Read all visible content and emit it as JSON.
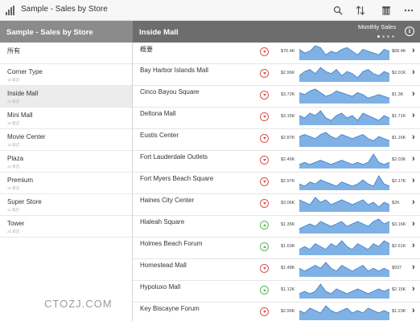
{
  "app": {
    "title": "Sample - Sales by Store"
  },
  "toolbar": {
    "search_icon": "search-icon",
    "sort_icon": "sort-icon",
    "columns_icon": "columns-icon",
    "more_icon": "more-icon"
  },
  "sidebar": {
    "header": "Sample - Sales by Store",
    "items": [
      {
        "label": "所有",
        "sub": ""
      },
      {
        "label": "Corner Type",
        "sub": "18 家店"
      },
      {
        "label": "Inside Mall",
        "sub": "22 家店"
      },
      {
        "label": "Mini Mall",
        "sub": "15 家店"
      },
      {
        "label": "Movie Center",
        "sub": "13 家店"
      },
      {
        "label": "Plaza",
        "sub": "14 家店"
      },
      {
        "label": "Premium",
        "sub": "19 家店"
      },
      {
        "label": "Super Store",
        "sub": "11 家店"
      },
      {
        "label": "Tower",
        "sub": "25 家店"
      }
    ],
    "selected_index": 2
  },
  "main": {
    "title": "Inside Mall",
    "subtitle": "Monthly Sales",
    "info_icon": "info-icon",
    "colors": {
      "down": "#d9534f",
      "up": "#5cb85c",
      "spark_fill": "#7fb1e4",
      "spark_line": "#3d7cc9"
    },
    "rows": [
      {
        "name": "概要",
        "trend": "down",
        "start": "$76.4K",
        "end": "$68.4K",
        "spark": [
          6,
          4,
          5,
          8,
          7,
          3,
          5,
          4,
          6,
          7,
          5,
          3,
          6,
          5,
          4,
          3,
          6,
          5
        ]
      },
      {
        "name": "Bay Harbor Islands Mall",
        "trend": "down",
        "start": "$2.96K",
        "end": "$2.01K",
        "spark": [
          3,
          5,
          6,
          4,
          7,
          5,
          4,
          6,
          3,
          5,
          4,
          2,
          5,
          6,
          4,
          3,
          5,
          4
        ]
      },
      {
        "name": "Cinco Bayou Square",
        "trend": "down",
        "start": "$3.72K",
        "end": "$1.3K",
        "spark": [
          6,
          5,
          7,
          8,
          6,
          4,
          5,
          7,
          6,
          5,
          4,
          6,
          5,
          3,
          4,
          5,
          4,
          3
        ]
      },
      {
        "name": "Deltona Mall",
        "trend": "down",
        "start": "$3.15K",
        "end": "$1.71K",
        "spark": [
          4,
          3,
          5,
          4,
          6,
          3,
          2,
          4,
          5,
          3,
          4,
          2,
          5,
          4,
          3,
          2,
          4,
          3
        ]
      },
      {
        "name": "Eustis Center",
        "trend": "down",
        "start": "$2.87K",
        "end": "$1.16K",
        "spark": [
          5,
          6,
          5,
          4,
          6,
          7,
          5,
          4,
          6,
          5,
          4,
          5,
          6,
          4,
          3,
          5,
          4,
          3
        ]
      },
      {
        "name": "Fort Lauderdale Outlets",
        "trend": "down",
        "start": "$2.46K",
        "end": "$2.03K",
        "spark": [
          2,
          3,
          2,
          3,
          4,
          3,
          2,
          3,
          4,
          3,
          2,
          3,
          2,
          3,
          7,
          3,
          2,
          3
        ]
      },
      {
        "name": "Fort Myers Beach Square",
        "trend": "down",
        "start": "$2.97K",
        "end": "$2.17K",
        "spark": [
          3,
          2,
          4,
          3,
          5,
          4,
          3,
          2,
          4,
          3,
          2,
          3,
          5,
          3,
          2,
          7,
          3,
          2
        ]
      },
      {
        "name": "Haines City Center",
        "trend": "down",
        "start": "$3.06K",
        "end": "$2K",
        "spark": [
          5,
          4,
          3,
          6,
          4,
          5,
          3,
          4,
          5,
          4,
          3,
          4,
          5,
          3,
          4,
          2,
          4,
          3
        ]
      },
      {
        "name": "Hialeah Square",
        "trend": "up",
        "start": "$1.35K",
        "end": "$3.16K",
        "spark": [
          2,
          3,
          4,
          3,
          5,
          4,
          3,
          4,
          5,
          3,
          4,
          5,
          4,
          3,
          5,
          6,
          4,
          5
        ]
      },
      {
        "name": "Holmes Beach Forum",
        "trend": "up",
        "start": "$1.63K",
        "end": "$2.61K",
        "spark": [
          2,
          3,
          2,
          4,
          3,
          2,
          4,
          3,
          5,
          3,
          2,
          4,
          3,
          2,
          4,
          3,
          5,
          4
        ]
      },
      {
        "name": "Homestead Mall",
        "trend": "down",
        "start": "$1.48K",
        "end": "$937",
        "spark": [
          3,
          2,
          3,
          4,
          3,
          5,
          3,
          2,
          4,
          3,
          2,
          3,
          4,
          2,
          3,
          2,
          3,
          2
        ]
      },
      {
        "name": "Hypoluxo Mall",
        "trend": "up",
        "start": "$1.12K",
        "end": "$2.15K",
        "spark": [
          2,
          3,
          2,
          3,
          6,
          3,
          2,
          4,
          3,
          2,
          3,
          4,
          3,
          2,
          3,
          4,
          3,
          4
        ]
      },
      {
        "name": "Key Biscayne Forum",
        "trend": "down",
        "start": "$2.96K",
        "end": "$1.23K",
        "spark": [
          4,
          3,
          5,
          4,
          3,
          6,
          4,
          3,
          4,
          5,
          3,
          4,
          3,
          5,
          4,
          3,
          4,
          3
        ]
      }
    ]
  },
  "watermark": "CTOZJ.COM"
}
